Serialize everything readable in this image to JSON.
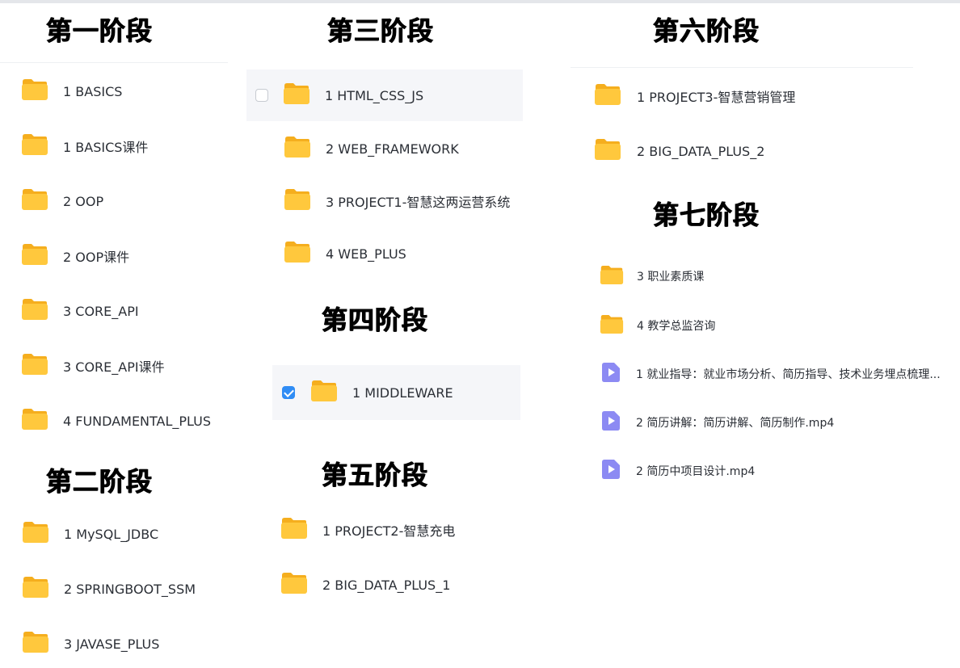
{
  "colors": {
    "folder": "#FFC83D",
    "folder_tab": "#F5AE1E",
    "video": "#8C8AF3",
    "check": "#2F8CF5"
  },
  "icons": {
    "folder": "folder-icon",
    "video": "video-file-icon"
  },
  "stages": {
    "s1": {
      "title": "第一阶段",
      "items": [
        "1 BASICS",
        "1 BASICS课件",
        "2 OOP",
        "2 OOP课件",
        "3 CORE_API",
        "3 CORE_API课件",
        "4 FUNDAMENTAL_PLUS"
      ]
    },
    "s2": {
      "title": "第二阶段",
      "items": [
        "1 MySQL_JDBC",
        "2 SPRINGBOOT_SSM",
        "3 JAVASE_PLUS"
      ]
    },
    "s3": {
      "title": "第三阶段",
      "items": [
        "1 HTML_CSS_JS",
        "2 WEB_FRAMEWORK",
        "3 PROJECT1-智慧这两运营系统",
        "4 WEB_PLUS"
      ]
    },
    "s4": {
      "title": "第四阶段",
      "items": [
        "1 MIDDLEWARE"
      ]
    },
    "s5": {
      "title": "第五阶段",
      "items": [
        "1 PROJECT2-智慧充电",
        "2 BIG_DATA_PLUS_1"
      ]
    },
    "s6": {
      "title": "第六阶段",
      "items": [
        "1 PROJECT3-智慧营销管理",
        "2 BIG_DATA_PLUS_2"
      ]
    },
    "s7": {
      "title": "第七阶段",
      "items": [
        "3 职业素质课",
        "4 教学总监咨询",
        "1 就业指导：就业市场分析、简历指导、技术业务埋点梳理...",
        "2 简历讲解：简历讲解、简历制作.mp4",
        "2 简历中项目设计.mp4"
      ]
    }
  }
}
